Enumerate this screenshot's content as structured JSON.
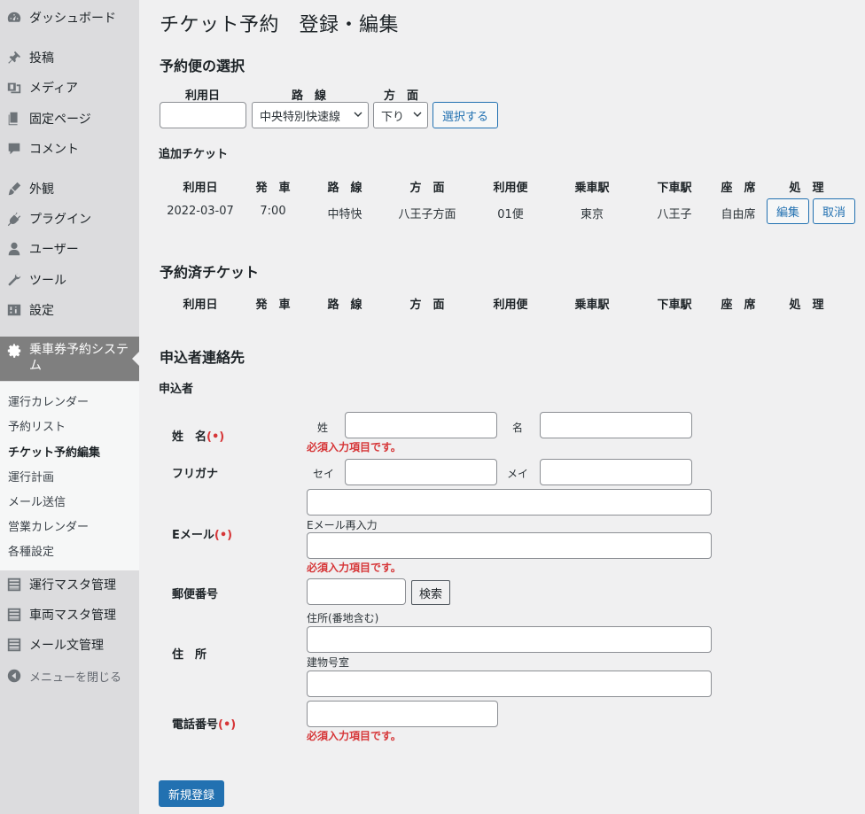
{
  "sidebar": {
    "items": [
      {
        "label": "ダッシュボード",
        "icon": "dashboard-icon"
      },
      {
        "label": "投稿",
        "icon": "pin-icon"
      },
      {
        "label": "メディア",
        "icon": "media-icon"
      },
      {
        "label": "固定ページ",
        "icon": "page-icon"
      },
      {
        "label": "コメント",
        "icon": "comment-icon"
      },
      {
        "label": "外観",
        "icon": "brush-icon"
      },
      {
        "label": "プラグイン",
        "icon": "plugin-icon"
      },
      {
        "label": "ユーザー",
        "icon": "user-icon"
      },
      {
        "label": "ツール",
        "icon": "wrench-icon"
      },
      {
        "label": "設定",
        "icon": "settings-icon"
      }
    ],
    "active": {
      "label": "乗車券予約システム",
      "icon": "gear-icon"
    },
    "submenu": [
      "運行カレンダー",
      "予約リスト",
      "チケット予約編集",
      "運行計画",
      "メール送信",
      "営業カレンダー",
      "各種設定"
    ],
    "submenu_current_index": 2,
    "bottom_items": [
      {
        "label": "運行マスタ管理",
        "icon": "list-icon"
      },
      {
        "label": "車両マスタ管理",
        "icon": "list-icon"
      },
      {
        "label": "メール文管理",
        "icon": "list-icon"
      }
    ],
    "collapse_label": "メニューを閉じる"
  },
  "page": {
    "title": "チケット予約　登録・編集",
    "select_section": {
      "heading": "予約便の選択",
      "date_label": "利用日",
      "route_label": "路　線",
      "direction_label": "方　面",
      "route_value": "中央特別快速線",
      "direction_value": "下り",
      "select_button": "選択する"
    },
    "added_tickets": {
      "heading": "追加チケット",
      "columns": [
        "利用日",
        "発　車",
        "路　線",
        "方　面",
        "利用便",
        "乗車駅",
        "下車駅",
        "座　席",
        "処　理"
      ],
      "rows": [
        {
          "date": "2022-03-07",
          "departure": "7:00",
          "route": "中特快",
          "direction": "八王子方面",
          "service": "01便",
          "board": "東京",
          "alight": "八王子",
          "seat": "自由席",
          "edit": "編集",
          "cancel": "取消"
        }
      ]
    },
    "reserved_tickets": {
      "heading": "予約済チケット",
      "columns": [
        "利用日",
        "発　車",
        "路　線",
        "方　面",
        "利用便",
        "乗車駅",
        "下車駅",
        "座　席",
        "処　理"
      ]
    },
    "contact": {
      "heading": "申込者連絡先",
      "subheading": "申込者",
      "name_label": "姓　名",
      "required_mark": "(•)",
      "last_name_label": "姓",
      "first_name_label": "名",
      "kana_label": "フリガナ",
      "kana_last_label": "セイ",
      "kana_first_label": "メイ",
      "email_label": "Eメール",
      "email_confirm_label": "Eメール再入力",
      "postal_label": "郵便番号",
      "search_button": "検索",
      "address_label": "住　所",
      "address_sub_label": "住所(番地含む)",
      "building_label": "建物号室",
      "phone_label": "電話番号",
      "required_error": "必須入力項目です。"
    },
    "submit_button": "新規登録"
  }
}
